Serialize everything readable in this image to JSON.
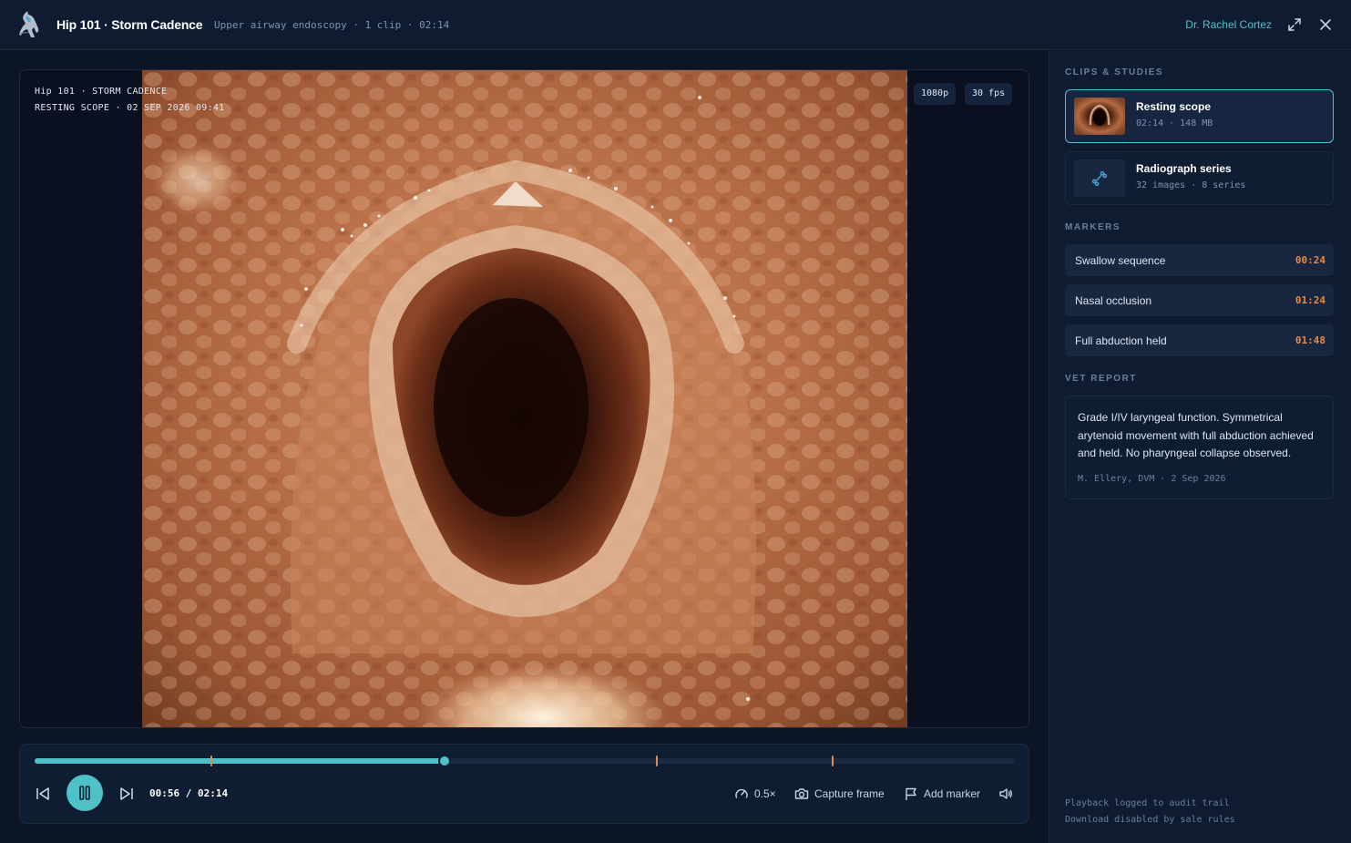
{
  "header": {
    "title": "Hip 101 · Storm Cadence",
    "subtitle": "Upper airway endoscopy · 1 clip · 02:14",
    "user": "Dr. Rachel Cortez",
    "expand_icon": "expand-icon",
    "close_icon": "close-icon"
  },
  "viewer": {
    "overlay_line1": "Hip 101 · STORM CADENCE",
    "overlay_line2": "RESTING SCOPE · 02 SEP 2026 09:41",
    "resolution": "1080p",
    "fps": "30 fps"
  },
  "player": {
    "progress": 0.418,
    "marker_positions": [
      0.179,
      0.634,
      0.813
    ],
    "time": "00:56 / 02:14",
    "speed": "0.5×",
    "capture_label": "Capture frame",
    "add_marker_label": "Add marker",
    "state": "playing"
  },
  "sidebar": {
    "clips_title": "CLIPS & STUDIES",
    "clips": [
      {
        "title": "Resting scope",
        "meta": "02:14 · 148 MB",
        "active": true
      },
      {
        "title": "Radiograph series",
        "meta": "32 images · 8 series",
        "icon": "bone-icon"
      }
    ],
    "markers_title": "MARKERS",
    "markers": [
      {
        "label": "Swallow sequence",
        "time": "00:24"
      },
      {
        "label": "Nasal occlusion",
        "time": "01:24"
      },
      {
        "label": "Full abduction held",
        "time": "01:48"
      }
    ],
    "report_title": "VET REPORT",
    "report_text": "Grade I/IV laryngeal function. Symmetrical arytenoid movement with full abduction achieved and held. No pharyngeal collapse observed.",
    "report_sign": "M. Ellery, DVM · 2 Sep 2026",
    "footer_line1": "Playback logged to audit trail",
    "footer_line2": "Download disabled by sale rules"
  },
  "colors": {
    "accent": "#4fc2c9",
    "marker": "#e78a48",
    "background": "#0b1526"
  }
}
